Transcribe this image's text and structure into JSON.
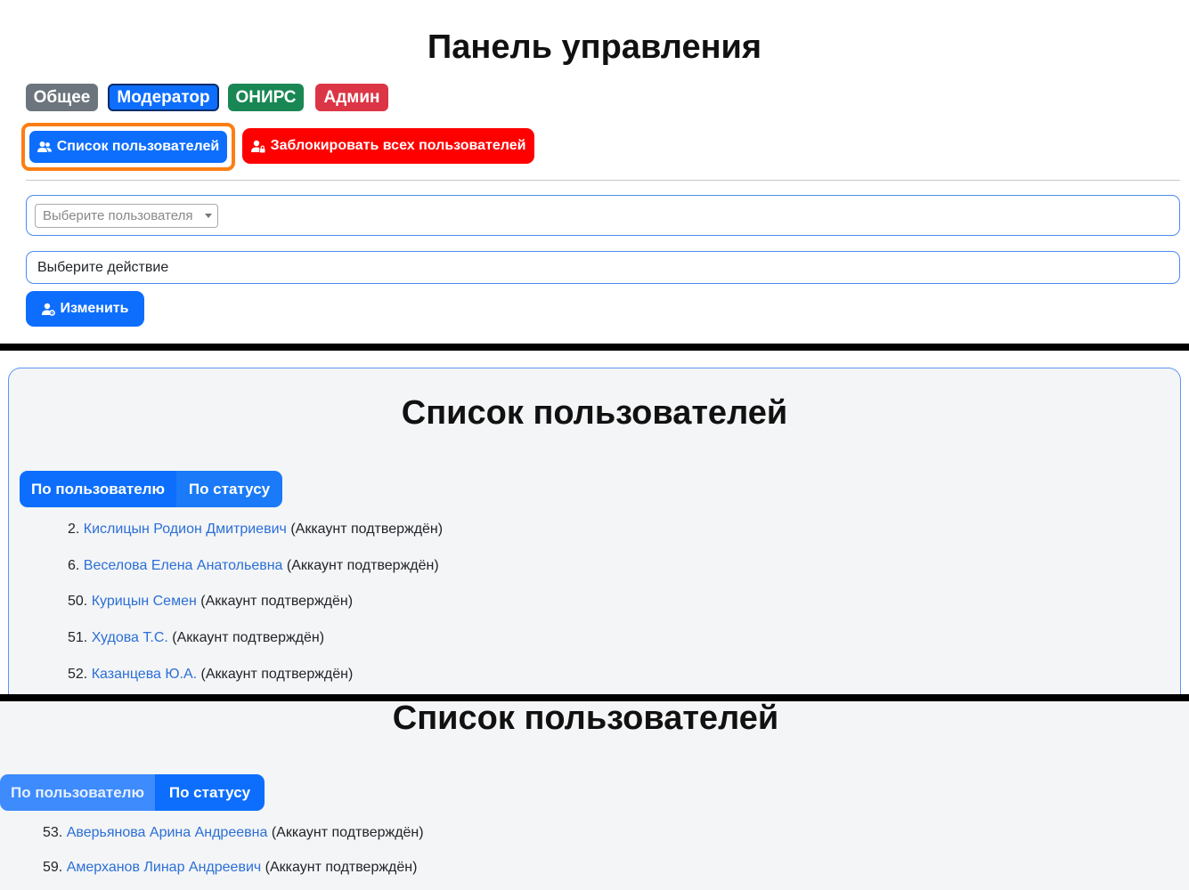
{
  "header": {
    "title": "Панель управления"
  },
  "badges": [
    {
      "label": "Общее",
      "color": "#6c757d"
    },
    {
      "label": "Модератор",
      "color": "#0d6efd"
    },
    {
      "label": "ОНИРС",
      "color": "#198754"
    },
    {
      "label": "Админ",
      "color": "#dc3545"
    }
  ],
  "actions": {
    "users_list_label": "Список пользователей",
    "block_all_label": "Заблокировать всех пользователей",
    "change_label": "Изменить"
  },
  "form": {
    "user_select_placeholder": "Выберите пользователя",
    "action_select_value": "Выберите действие"
  },
  "users_panel": {
    "title": "Список пользователей",
    "tabs": [
      {
        "label": "По пользователю",
        "active": true
      },
      {
        "label": "По статусу",
        "active": false
      }
    ],
    "items": [
      {
        "num": "2.",
        "name": "Кислицын Родион Дмитриевич",
        "status": "(Аккаунт подтверждён)"
      },
      {
        "num": "6.",
        "name": "Веселова Елена Анатольевна",
        "status": "(Аккаунт подтверждён)"
      },
      {
        "num": "50.",
        "name": "Курицын Семен",
        "status": "(Аккаунт подтверждён)"
      },
      {
        "num": "51.",
        "name": "Худова Т.С.",
        "status": "(Аккаунт подтверждён)"
      },
      {
        "num": "52.",
        "name": "Казанцева Ю.А.",
        "status": "(Аккаунт подтверждён)"
      }
    ]
  },
  "users_panel_2": {
    "title": "Список пользователей",
    "tabs": [
      {
        "label": "По пользователю",
        "active": false
      },
      {
        "label": "По статусу",
        "active": true
      }
    ],
    "items": [
      {
        "num": "53.",
        "name": "Аверьянова Арина Андреевна",
        "status": "(Аккаунт подтверждён)"
      },
      {
        "num": "59.",
        "name": "Амерханов Линар Андреевич",
        "status": "(Аккаунт подтверждён)"
      }
    ]
  },
  "icons": {
    "users": "users-icon",
    "user_lock": "user-lock-icon",
    "user_gear": "user-gear-icon"
  }
}
